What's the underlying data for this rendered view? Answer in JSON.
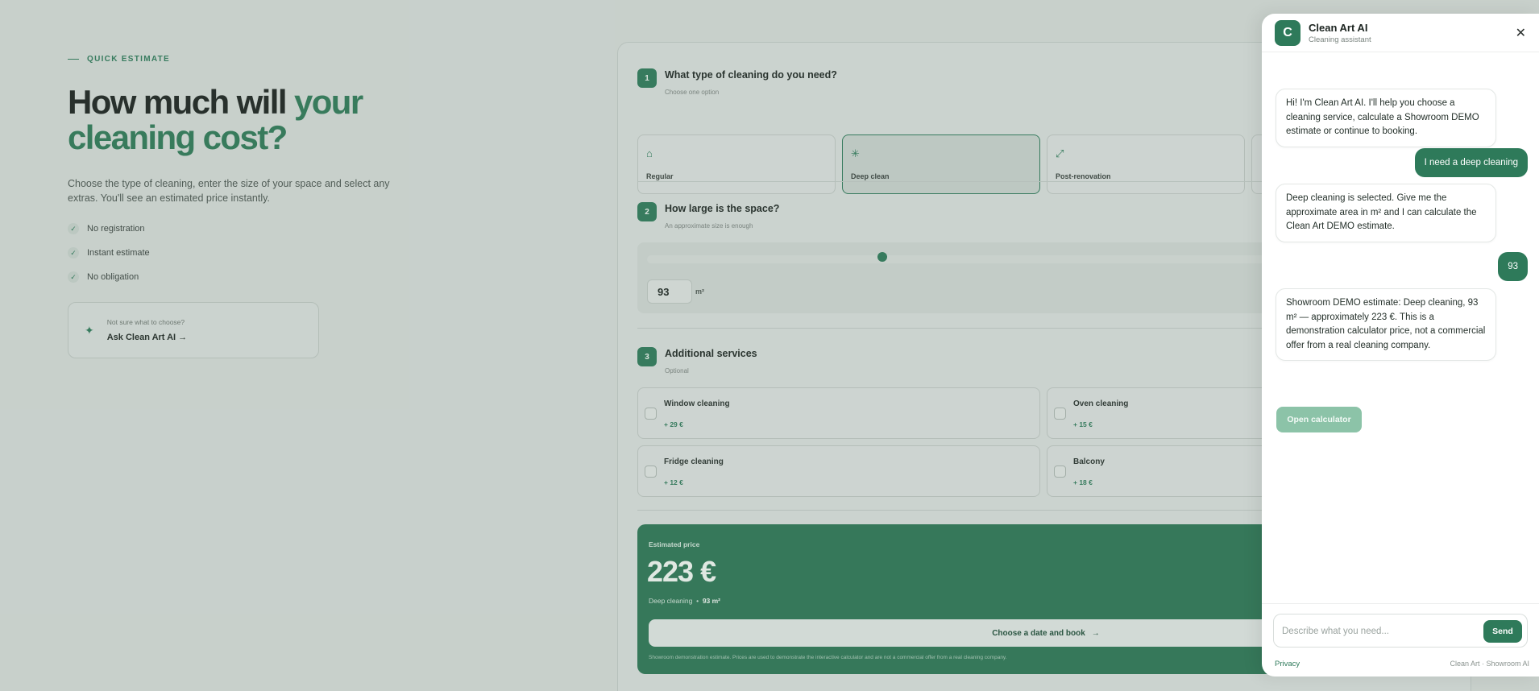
{
  "hero": {
    "eyebrow": "QUICK ESTIMATE",
    "headline_plain": "How much will ",
    "headline_accent_1": "your",
    "headline_accent_2": "cleaning cost?",
    "lead": "Choose the type of cleaning, enter the size of your space and select any extras. You'll see an estimated price instantly.",
    "checks": [
      "No registration",
      "Instant estimate",
      "No obligation"
    ],
    "ask_small": "Not sure what to choose?",
    "ask_link": "Ask Clean Art AI →"
  },
  "calculator": {
    "step1": {
      "number": "1",
      "title": "What type of cleaning do you need?",
      "subtitle": "Choose one option",
      "types": [
        {
          "label": "Regular",
          "icon": "home-icon",
          "selected": false
        },
        {
          "label": "Deep clean",
          "icon": "sparkle-icon",
          "selected": true
        },
        {
          "label": "Post-renovation",
          "icon": "tools-icon",
          "selected": false
        }
      ]
    },
    "step2": {
      "number": "2",
      "title": "How large is the space?",
      "subtitle": "An approximate size is enough",
      "value": "93",
      "unit": "m²"
    },
    "step3": {
      "number": "3",
      "title": "Additional services",
      "subtitle": "Optional",
      "extras": [
        {
          "name": "Window cleaning",
          "price": "+ 29 €"
        },
        {
          "name": "Oven cleaning",
          "price": "+ 15 €"
        },
        {
          "name": "Fridge cleaning",
          "price": "+ 12 €"
        },
        {
          "name": "Balcony",
          "price": "+ 18 €"
        }
      ]
    },
    "result": {
      "label": "Estimated price",
      "price": "223 €",
      "summary_type": "Deep cleaning",
      "summary_sep": "•",
      "summary_size": "93 m²",
      "book_label": "Choose a date and book",
      "disclaimer": "Showroom demonstration estimate. Prices are used to demonstrate the interactive calculator and are not a commercial offer from a real cleaning company."
    }
  },
  "chat": {
    "avatar_letter": "C",
    "name": "Clean Art AI",
    "role": "Cleaning assistant",
    "messages": [
      {
        "from": "bot",
        "text": "Hi! I'm Clean Art AI. I'll help you choose a cleaning service, calculate a Showroom DEMO estimate or continue to booking."
      },
      {
        "from": "user",
        "text": "I need a deep cleaning"
      },
      {
        "from": "bot",
        "text": "Deep cleaning is selected. Give me the approximate area in m² and I can calculate the Clean Art DEMO estimate."
      },
      {
        "from": "user",
        "text": "93"
      },
      {
        "from": "bot",
        "text": "Showroom DEMO estimate: Deep cleaning, 93 m² — approximately 223 €. This is a demonstration calculator price, not a commercial offer from a real cleaning company."
      }
    ],
    "open_calculator": "Open calculator",
    "input_placeholder": "Describe what you need...",
    "send_label": "Send",
    "privacy": "Privacy",
    "brand": "Clean Art · Showroom AI"
  },
  "colors": {
    "accent": "#2e7a5a",
    "background": "#d3dbd7",
    "price_card": "#2d7756"
  }
}
